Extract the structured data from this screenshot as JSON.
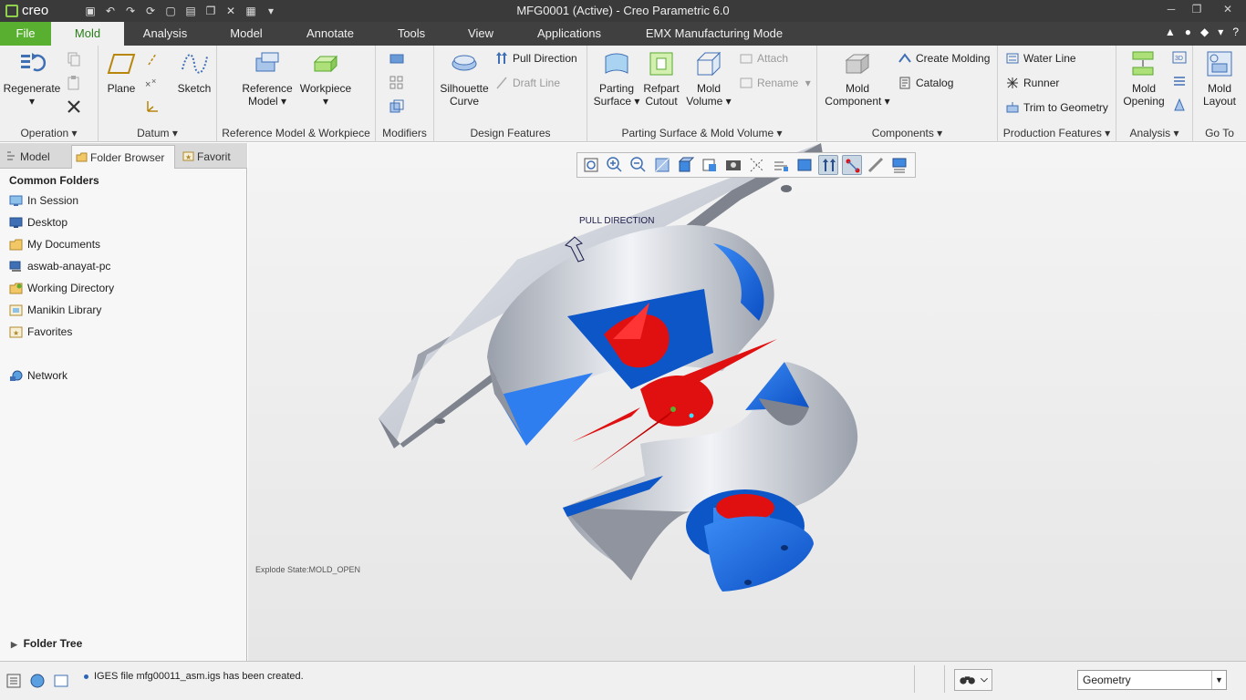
{
  "app": {
    "logo_text": "creo",
    "window_title": "MFG0001 (Active) - Creo Parametric 6.0"
  },
  "tabs": [
    {
      "label": "File"
    },
    {
      "label": "Mold"
    },
    {
      "label": "Analysis"
    },
    {
      "label": "Model"
    },
    {
      "label": "Annotate"
    },
    {
      "label": "Tools"
    },
    {
      "label": "View"
    },
    {
      "label": "Applications"
    },
    {
      "label": "EMX Manufacturing Mode"
    }
  ],
  "ribbon": {
    "operation": {
      "regenerate": "Regenerate",
      "label": "Operation ▾"
    },
    "datum": {
      "plane": "Plane",
      "sketch": "Sketch",
      "label": "Datum ▾"
    },
    "refmodel": {
      "reference_model_l1": "Reference",
      "reference_model_l2": "Model ▾",
      "workpiece": "Workpiece",
      "label": "Reference Model & Workpiece"
    },
    "modifiers": {
      "label": "Modifiers"
    },
    "design": {
      "silhouette_l1": "Silhouette",
      "silhouette_l2": "Curve",
      "pull_direction": "Pull Direction",
      "draft_line": "Draft Line",
      "label": "Design Features"
    },
    "parting": {
      "parting_l1": "Parting",
      "parting_l2": "Surface ▾",
      "refpart_l1": "Refpart",
      "refpart_l2": "Cutout",
      "moldvol_l1": "Mold",
      "moldvol_l2": "Volume ▾",
      "attach": "Attach",
      "rename": "Rename",
      "label": "Parting Surface & Mold Volume ▾"
    },
    "components": {
      "mold_component_l1": "Mold",
      "mold_component_l2": "Component ▾",
      "create_molding": "Create Molding",
      "catalog": "Catalog",
      "label": "Components ▾"
    },
    "production": {
      "water_line": "Water Line",
      "runner": "Runner",
      "trim_to_geometry": "Trim to Geometry",
      "label": "Production Features ▾"
    },
    "analysis": {
      "mold_opening_l1": "Mold",
      "mold_opening_l2": "Opening",
      "label": "Analysis ▾"
    },
    "goto": {
      "mold_layout_l1": "Mold",
      "mold_layout_l2": "Layout",
      "label": "Go To"
    }
  },
  "left_panel": {
    "tabs": [
      "Model",
      "Folder Browser",
      "Favorit"
    ],
    "common_folders_title": "Common Folders",
    "folders": [
      "In Session",
      "Desktop",
      "My Documents",
      "aswab-anayat-pc",
      "Working Directory",
      "Manikin Library",
      "Favorites"
    ],
    "network": "Network",
    "folder_tree": "Folder Tree"
  },
  "viewport": {
    "pull_direction_label": "PULL DIRECTION",
    "explode_state": "Explode State:MOLD_OPEN"
  },
  "status": {
    "message": "IGES file mfg00011_asm.igs has been created.",
    "filter_value": "Geometry"
  },
  "colors": {
    "accent_green": "#59b030",
    "tab_bar": "#404040",
    "part_gray": "#c7ccd6",
    "cavity_blue": "#1f6fe0",
    "molding_red": "#e01010"
  }
}
